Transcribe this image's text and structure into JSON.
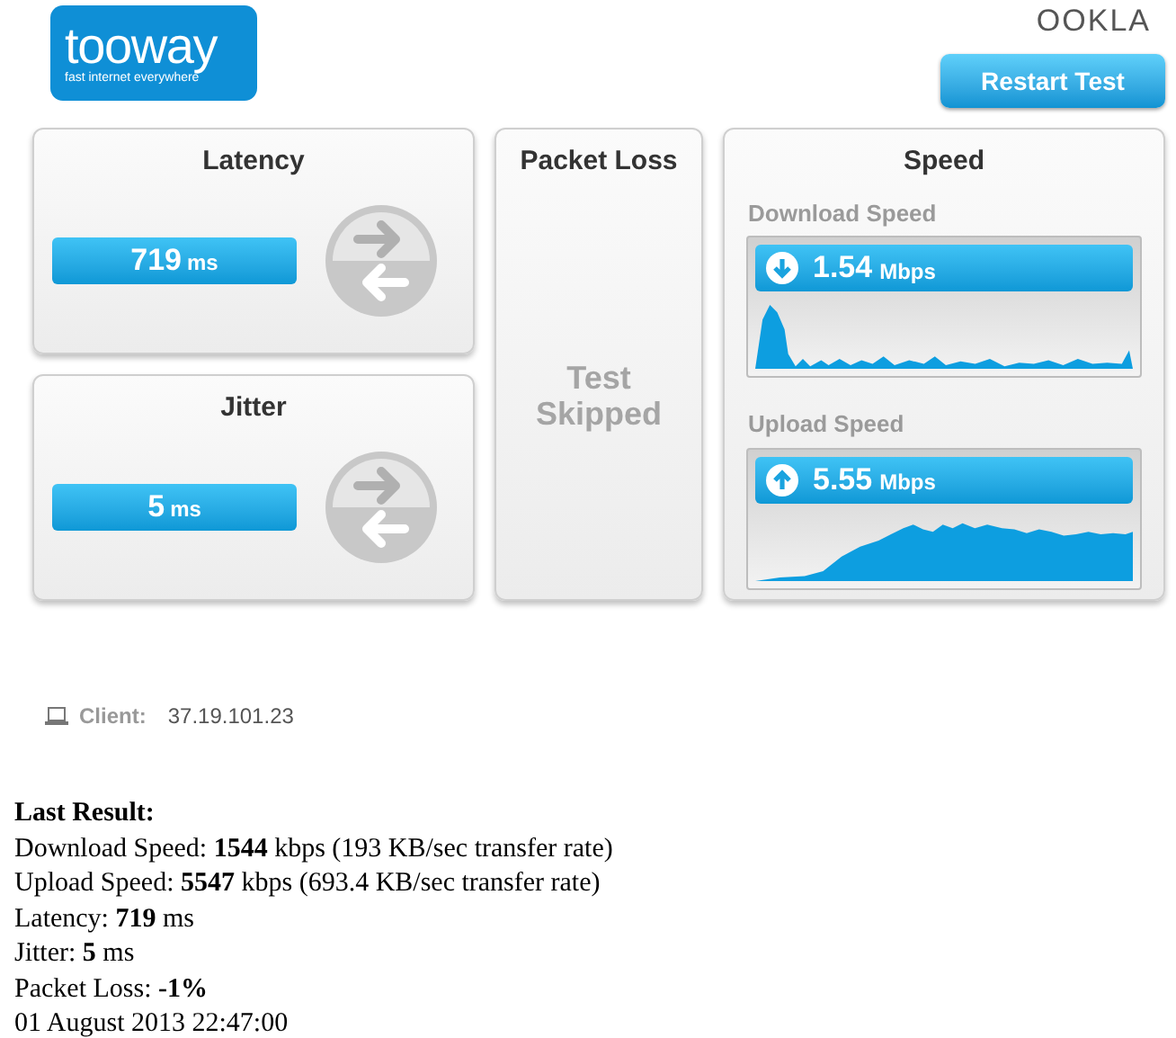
{
  "logo": {
    "name": "tooway",
    "tagline": "fast internet everywhere"
  },
  "brand": "OOKLA",
  "restart_button": "Restart Test",
  "metrics": [
    {
      "title": "Latency",
      "value": "719",
      "unit": "ms"
    },
    {
      "title": "Jitter",
      "value": "5",
      "unit": "ms"
    }
  ],
  "packet_loss": {
    "title": "Packet Loss",
    "status": "Test Skipped"
  },
  "speed": {
    "title": "Speed",
    "tests": [
      {
        "kind": "download",
        "label": "Download Speed",
        "value": "1.54",
        "unit": "Mbps"
      },
      {
        "kind": "upload",
        "label": "Upload Speed",
        "value": "5.55",
        "unit": "Mbps"
      }
    ]
  },
  "client": {
    "label": "Client:",
    "ip": "37.19.101.23"
  },
  "last_result": {
    "title": "Last Result:",
    "lines": [
      "Download Speed: **1544** kbps (193 KB/sec transfer rate)",
      "Upload Speed: **5547** kbps (693.4 KB/sec transfer rate)",
      "Latency: **719** ms",
      "Jitter: **5** ms",
      "Packet Loss: **-1%**",
      "01 August 2013 22:47:00"
    ]
  }
}
